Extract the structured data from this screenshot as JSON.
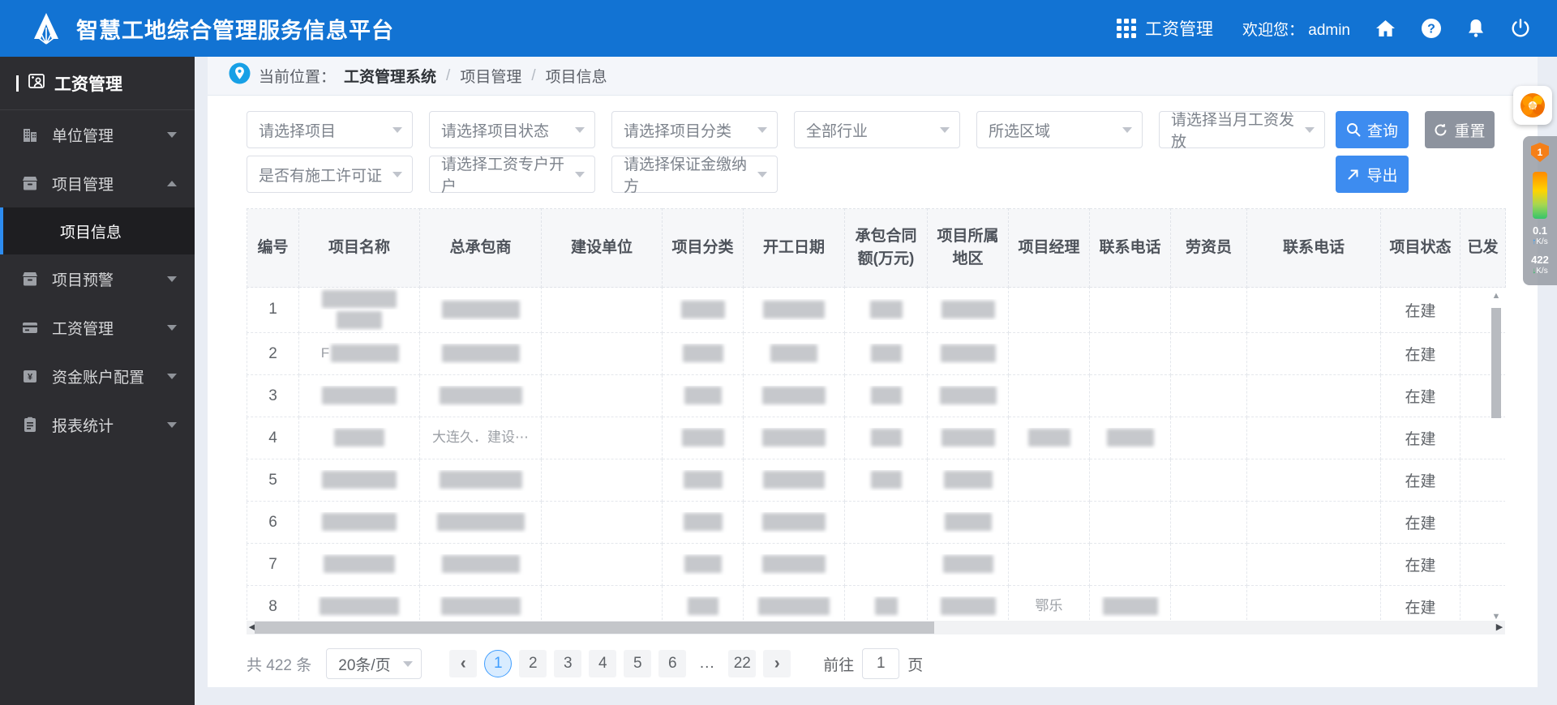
{
  "app": {
    "title": "智慧工地综合管理服务信息平台"
  },
  "header": {
    "module": "工资管理",
    "welcome_label": "欢迎您：",
    "username": "admin"
  },
  "sidebar": {
    "title": "工资管理",
    "items": [
      {
        "label": "单位管理",
        "icon": "building-icon",
        "caret": "down"
      },
      {
        "label": "项目管理",
        "icon": "project-box-icon",
        "caret": "up",
        "children": [
          {
            "label": "项目信息",
            "active": true
          }
        ]
      },
      {
        "label": "项目预警",
        "icon": "alert-box-icon",
        "caret": "down"
      },
      {
        "label": "工资管理",
        "icon": "wallet-icon",
        "caret": "down"
      },
      {
        "label": "资金账户配置",
        "icon": "fund-account-icon",
        "caret": "down"
      },
      {
        "label": "报表统计",
        "icon": "report-icon",
        "caret": "down"
      }
    ]
  },
  "breadcrumb": {
    "prefix": "当前位置：",
    "root": "工资管理系统",
    "items": [
      "项目管理",
      "项目信息"
    ]
  },
  "filters": {
    "row1": [
      "请选择项目",
      "请选择项目状态",
      "请选择项目分类",
      "全部行业",
      "所选区域",
      "请选择当月工资发放"
    ],
    "row2": [
      "是否有施工许可证",
      "请选择工资专户开户",
      "请选择保证金缴纳方"
    ],
    "search": "查询",
    "reset": "重置",
    "export": "导出"
  },
  "table": {
    "columns": [
      "编号",
      "项目名称",
      "总承包商",
      "建设单位",
      "项目分类",
      "开工日期",
      "承包合同额(万元)",
      "项目所属地区",
      "项目经理",
      "联系电话",
      "劳资员",
      "联系电话",
      "项目状态",
      "已发"
    ],
    "rows": [
      {
        "no": "1",
        "status": "在建",
        "cells": {
          "1": [
            {
              "b": 92
            },
            {
              "b": 56
            }
          ],
          "2": [
            {
              "b": 96
            }
          ],
          "4": [
            {
              "b": 54
            }
          ],
          "5": [
            {
              "b": 76
            }
          ],
          "6": [
            {
              "b": 40
            }
          ],
          "7": [
            {
              "b": 66
            }
          ]
        }
      },
      {
        "no": "2",
        "status": "在建",
        "cells": {
          "1": [
            {
              "t": "F",
              "b": 84
            }
          ],
          "2": [
            {
              "b": 96
            }
          ],
          "4": [
            {
              "b": 50
            }
          ],
          "5": [
            {
              "b": 58
            }
          ],
          "6": [
            {
              "b": 38
            }
          ],
          "7": [
            {
              "b": 68
            }
          ]
        }
      },
      {
        "no": "3",
        "status": "在建",
        "cells": {
          "1": [
            {
              "b": 92
            }
          ],
          "2": [
            {
              "b": 102
            }
          ],
          "4": [
            {
              "b": 46
            }
          ],
          "5": [
            {
              "b": 78
            }
          ],
          "6": [
            {
              "b": 38
            }
          ],
          "7": [
            {
              "b": 70
            }
          ]
        }
      },
      {
        "no": "4",
        "status": "在建",
        "cells": {
          "1": [
            {
              "b": 62
            }
          ],
          "2": [
            {
              "t": "大连久．建设⋯"
            }
          ],
          "4": [
            {
              "b": 52
            }
          ],
          "5": [
            {
              "b": 78
            }
          ],
          "6": [
            {
              "b": 38
            }
          ],
          "7": [
            {
              "b": 66
            }
          ],
          "8": [
            {
              "b": 52
            }
          ],
          "9": [
            {
              "b": 58
            }
          ]
        }
      },
      {
        "no": "5",
        "status": "在建",
        "cells": {
          "1": [
            {
              "b": 92
            }
          ],
          "2": [
            {
              "b": 102
            }
          ],
          "4": [
            {
              "b": 48
            }
          ],
          "5": [
            {
              "b": 76
            }
          ],
          "6": [
            {
              "b": 38
            }
          ],
          "7": [
            {
              "b": 60
            }
          ]
        }
      },
      {
        "no": "6",
        "status": "在建",
        "cells": {
          "1": [
            {
              "b": 92
            }
          ],
          "2": [
            {
              "b": 108
            }
          ],
          "4": [
            {
              "b": 48
            }
          ],
          "5": [
            {
              "b": 78
            }
          ],
          "7": [
            {
              "b": 58
            }
          ]
        }
      },
      {
        "no": "7",
        "status": "在建",
        "cells": {
          "1": [
            {
              "b": 88
            }
          ],
          "2": [
            {
              "b": 96
            }
          ],
          "4": [
            {
              "b": 46
            }
          ],
          "5": [
            {
              "b": 78
            }
          ],
          "7": [
            {
              "b": 62
            }
          ]
        }
      },
      {
        "no": "8",
        "status": "在建",
        "cells": {
          "1": [
            {
              "b": 98
            }
          ],
          "2": [
            {
              "b": 98
            }
          ],
          "4": [
            {
              "b": 38
            }
          ],
          "5": [
            {
              "b": 88
            }
          ],
          "6": [
            {
              "b": 28
            }
          ],
          "7": [
            {
              "b": 68
            }
          ],
          "8": [
            {
              "t": "鄂乐"
            }
          ],
          "9": [
            {
              "b": 68
            }
          ]
        }
      }
    ]
  },
  "pagination": {
    "total": "共 422 条",
    "page_size": "20条/页",
    "pages": [
      "1",
      "2",
      "3",
      "4",
      "5",
      "6",
      "...",
      "22"
    ],
    "active": "1",
    "prev": "‹",
    "next": "›",
    "goto_label": "前往",
    "goto_value": "1",
    "goto_unit": "页"
  },
  "netwidget": {
    "badge": "1",
    "up": "0.1",
    "up_unit": "K/s",
    "down": "422",
    "down_unit": "K/s"
  },
  "colors": {
    "header": "#1273d3",
    "primary": "#3d8cf0",
    "reset": "#8d939e",
    "sidebar": "#2d2d31",
    "sidebar_active": "#1e1e21",
    "page_bg": "#e9edf4",
    "link_active": "#409eff"
  }
}
